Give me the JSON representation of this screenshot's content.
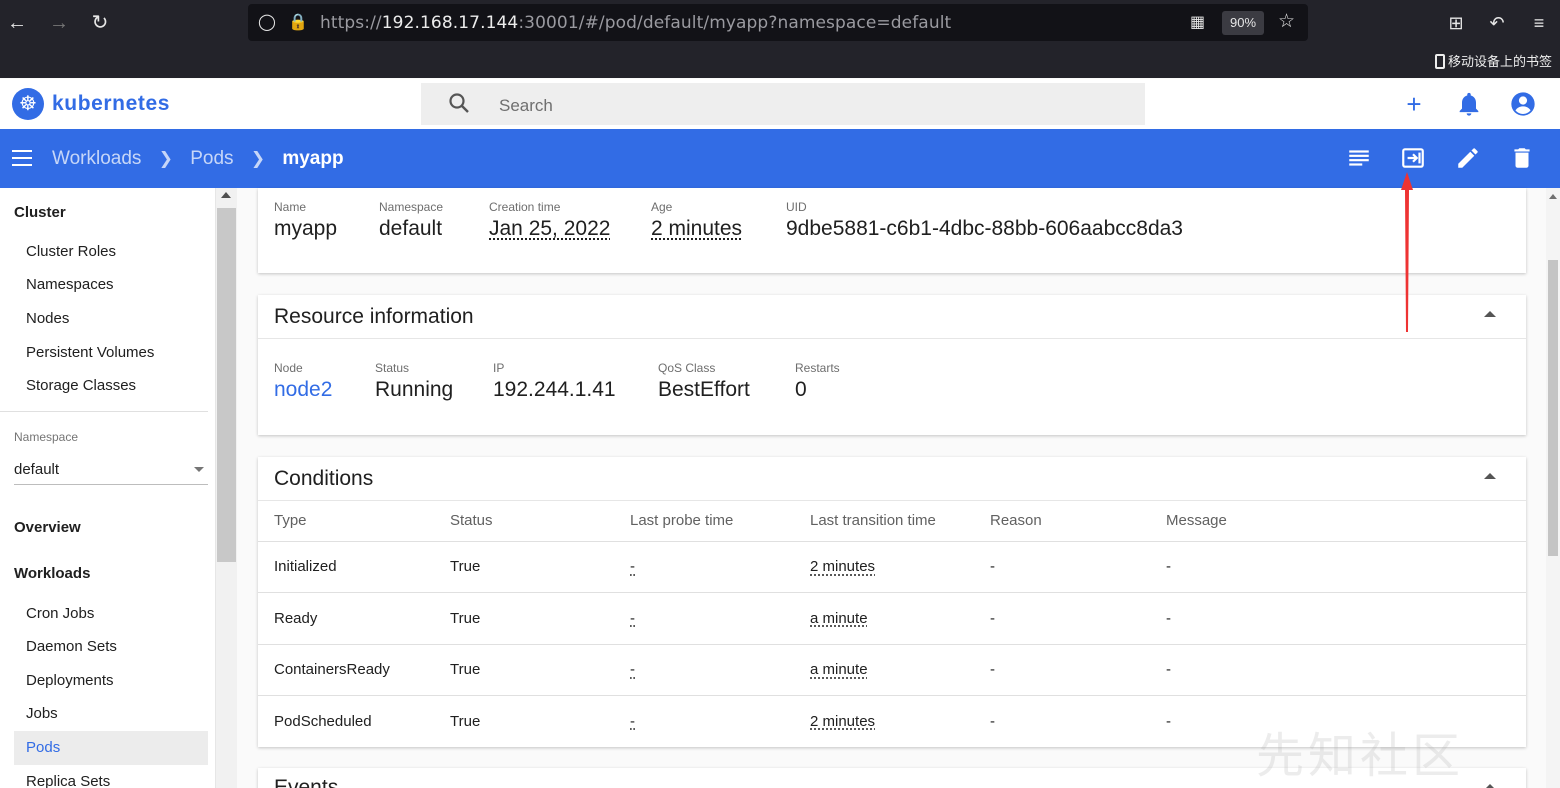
{
  "browser": {
    "url_prefix": "https://",
    "url_host": "192.168.17.144",
    "url_rest": ":30001/#/pod/default/myapp?namespace=default",
    "zoom": "90%",
    "bookmark_label": "移动设备上的书签"
  },
  "app": {
    "brand": "kubernetes",
    "search_placeholder": "Search"
  },
  "breadcrumb": {
    "items": [
      "Workloads",
      "Pods"
    ],
    "current": "myapp"
  },
  "sidebar": {
    "cluster_heading": "Cluster",
    "cluster_items": [
      "Cluster Roles",
      "Namespaces",
      "Nodes",
      "Persistent Volumes",
      "Storage Classes"
    ],
    "namespace_label": "Namespace",
    "namespace_value": "default",
    "overview": "Overview",
    "workloads_heading": "Workloads",
    "workload_items": [
      "Cron Jobs",
      "Daemon Sets",
      "Deployments",
      "Jobs",
      "Pods",
      "Replica Sets"
    ],
    "active_item": "Pods"
  },
  "metadata": {
    "name_label": "Name",
    "name": "myapp",
    "namespace_label": "Namespace",
    "namespace": "default",
    "creation_label": "Creation time",
    "creation": "Jan 25, 2022",
    "age_label": "Age",
    "age": "2 minutes",
    "uid_label": "UID",
    "uid": "9dbe5881-c6b1-4dbc-88bb-606aabcc8da3"
  },
  "resource": {
    "title": "Resource information",
    "node_label": "Node",
    "node": "node2",
    "status_label": "Status",
    "status": "Running",
    "ip_label": "IP",
    "ip": "192.244.1.41",
    "qos_label": "QoS Class",
    "qos": "BestEffort",
    "restarts_label": "Restarts",
    "restarts": "0"
  },
  "conditions": {
    "title": "Conditions",
    "columns": [
      "Type",
      "Status",
      "Last probe time",
      "Last transition time",
      "Reason",
      "Message"
    ],
    "rows": [
      [
        "Initialized",
        "True",
        "-",
        "2 minutes",
        "-",
        "-"
      ],
      [
        "Ready",
        "True",
        "-",
        "a minute",
        "-",
        "-"
      ],
      [
        "ContainersReady",
        "True",
        "-",
        "a minute",
        "-",
        "-"
      ],
      [
        "PodScheduled",
        "True",
        "-",
        "2 minutes",
        "-",
        "-"
      ]
    ]
  },
  "events": {
    "title": "Events"
  },
  "watermark": "先知社区",
  "colors": {
    "brand": "#326ce5",
    "annotation": "#ee3333"
  }
}
